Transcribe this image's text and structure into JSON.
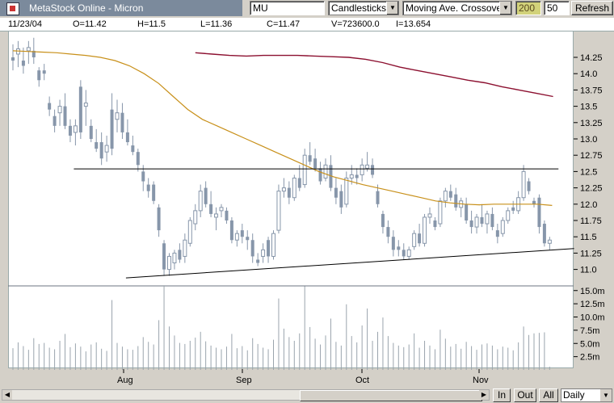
{
  "app": {
    "title": "MetaStock Online - Micron"
  },
  "toolbar": {
    "symbol_value": "MU",
    "chart_type": "Candlesticks",
    "indicator": "Moving Ave. Crossover",
    "period1": "200",
    "period2": "50",
    "refresh_label": "Refresh"
  },
  "quote": {
    "date": "11/23/04",
    "open": "O=11.42",
    "high": "H=11.5",
    "low": "L=11.36",
    "close": "C=11.47",
    "volume": "V=723600.0",
    "interest": "I=13.654"
  },
  "chart_data": {
    "type": "candlestick",
    "price_axis": {
      "ticks": [
        "14.25",
        "14.0",
        "13.75",
        "13.5",
        "13.25",
        "13.0",
        "12.75",
        "12.5",
        "12.25",
        "12.0",
        "11.75",
        "11.5",
        "11.25",
        "11.0"
      ],
      "range": [
        10.8,
        14.75
      ]
    },
    "volume_axis": {
      "ticks": [
        "15.0m",
        "12.5m",
        "10.0m",
        "7.5m",
        "5.0m",
        "2.5m"
      ],
      "range": [
        0,
        18
      ]
    },
    "x_labels": [
      "Aug",
      "Sep",
      "Oct",
      "Nov"
    ],
    "candles": [
      [
        14.25,
        14.45,
        14.05,
        14.2
      ],
      [
        14.3,
        14.5,
        14.1,
        14.38
      ],
      [
        14.2,
        14.4,
        14.0,
        14.12
      ],
      [
        14.35,
        14.5,
        14.15,
        14.4
      ],
      [
        14.35,
        14.55,
        14.15,
        14.25
      ],
      [
        14.05,
        14.1,
        13.8,
        13.9
      ],
      [
        14.05,
        14.15,
        13.9,
        14.0
      ],
      [
        13.55,
        13.65,
        13.35,
        13.45
      ],
      [
        13.35,
        13.45,
        13.1,
        13.2
      ],
      [
        13.4,
        13.6,
        13.2,
        13.5
      ],
      [
        13.5,
        13.7,
        13.15,
        13.2
      ],
      [
        13.2,
        13.3,
        12.95,
        13.05
      ],
      [
        13.1,
        13.3,
        12.9,
        13.2
      ],
      [
        13.8,
        13.9,
        13.0,
        13.1
      ],
      [
        13.5,
        13.75,
        13.2,
        13.55
      ],
      [
        13.2,
        13.3,
        12.95,
        13.0
      ],
      [
        12.95,
        13.15,
        12.8,
        12.85
      ],
      [
        12.95,
        13.1,
        12.6,
        12.7
      ],
      [
        12.8,
        13.05,
        12.65,
        12.9
      ],
      [
        13.45,
        13.7,
        12.75,
        12.85
      ],
      [
        13.3,
        13.6,
        13.1,
        13.4
      ],
      [
        13.4,
        13.55,
        13.0,
        13.1
      ],
      [
        13.1,
        13.3,
        12.9,
        12.95
      ],
      [
        12.9,
        13.05,
        12.75,
        12.8
      ],
      [
        12.8,
        12.85,
        12.5,
        12.6
      ],
      [
        12.5,
        12.6,
        12.2,
        12.35
      ],
      [
        12.3,
        12.4,
        12.1,
        12.2
      ],
      [
        12.3,
        12.35,
        12.0,
        12.05
      ],
      [
        11.95,
        12.0,
        11.5,
        11.6
      ],
      [
        11.4,
        11.45,
        10.9,
        11.0
      ],
      [
        11.0,
        11.25,
        10.9,
        11.2
      ],
      [
        11.1,
        11.3,
        11.0,
        11.25
      ],
      [
        11.3,
        11.4,
        11.1,
        11.15
      ],
      [
        11.2,
        11.55,
        11.1,
        11.45
      ],
      [
        11.4,
        11.8,
        11.35,
        11.75
      ],
      [
        11.7,
        12.0,
        11.6,
        11.9
      ],
      [
        11.9,
        12.3,
        11.8,
        12.2
      ],
      [
        12.25,
        12.35,
        11.95,
        12.0
      ],
      [
        12.0,
        12.2,
        11.8,
        11.85
      ],
      [
        11.8,
        11.95,
        11.6,
        11.85
      ],
      [
        11.9,
        12.0,
        11.8,
        11.95
      ],
      [
        11.9,
        11.95,
        11.7,
        11.75
      ],
      [
        11.75,
        11.8,
        11.4,
        11.45
      ],
      [
        11.45,
        11.6,
        11.35,
        11.55
      ],
      [
        11.6,
        11.7,
        11.4,
        11.5
      ],
      [
        11.5,
        11.6,
        11.3,
        11.45
      ],
      [
        11.45,
        11.55,
        11.1,
        11.2
      ],
      [
        11.15,
        11.25,
        11.05,
        11.1
      ],
      [
        11.2,
        11.4,
        11.1,
        11.3
      ],
      [
        11.45,
        11.5,
        11.1,
        11.2
      ],
      [
        11.2,
        11.6,
        11.15,
        11.55
      ],
      [
        11.6,
        12.3,
        11.55,
        12.2
      ],
      [
        12.2,
        12.4,
        12.1,
        12.25
      ],
      [
        12.25,
        12.35,
        12.0,
        12.1
      ],
      [
        12.1,
        12.45,
        12.05,
        12.4
      ],
      [
        12.4,
        12.6,
        12.2,
        12.25
      ],
      [
        12.3,
        12.85,
        12.25,
        12.75
      ],
      [
        12.75,
        12.95,
        12.6,
        12.65
      ],
      [
        12.7,
        12.85,
        12.5,
        12.55
      ],
      [
        12.55,
        12.65,
        12.3,
        12.35
      ],
      [
        12.4,
        12.7,
        12.35,
        12.6
      ],
      [
        12.6,
        12.75,
        12.2,
        12.25
      ],
      [
        12.25,
        12.4,
        12.0,
        12.1
      ],
      [
        12.2,
        12.3,
        11.85,
        11.95
      ],
      [
        12.0,
        12.5,
        11.95,
        12.4
      ],
      [
        12.4,
        12.6,
        12.3,
        12.45
      ],
      [
        12.45,
        12.55,
        12.3,
        12.4
      ],
      [
        12.45,
        12.7,
        12.35,
        12.6
      ],
      [
        12.55,
        12.8,
        12.5,
        12.6
      ],
      [
        12.6,
        12.7,
        12.4,
        12.45
      ],
      [
        12.2,
        12.3,
        11.95,
        12.0
      ],
      [
        11.85,
        11.9,
        11.55,
        11.65
      ],
      [
        11.65,
        11.75,
        11.4,
        11.5
      ],
      [
        11.5,
        11.6,
        11.2,
        11.3
      ],
      [
        11.35,
        11.45,
        11.2,
        11.3
      ],
      [
        11.3,
        11.4,
        11.15,
        11.2
      ],
      [
        11.2,
        11.35,
        11.15,
        11.3
      ],
      [
        11.35,
        11.6,
        11.3,
        11.55
      ],
      [
        11.55,
        11.7,
        11.35,
        11.4
      ],
      [
        11.4,
        11.85,
        11.35,
        11.8
      ],
      [
        11.8,
        11.95,
        11.7,
        11.85
      ],
      [
        11.75,
        11.8,
        11.6,
        11.65
      ],
      [
        11.7,
        12.1,
        11.65,
        12.05
      ],
      [
        12.05,
        12.25,
        11.95,
        12.2
      ],
      [
        12.2,
        12.3,
        12.05,
        12.1
      ],
      [
        12.15,
        12.25,
        11.9,
        11.95
      ],
      [
        11.95,
        12.1,
        11.8,
        12.05
      ],
      [
        12.0,
        12.1,
        11.7,
        11.75
      ],
      [
        11.75,
        11.9,
        11.55,
        11.65
      ],
      [
        11.65,
        11.85,
        11.55,
        11.8
      ],
      [
        11.8,
        12.0,
        11.65,
        11.7
      ],
      [
        11.7,
        11.9,
        11.55,
        11.85
      ],
      [
        11.85,
        11.95,
        11.6,
        11.65
      ],
      [
        11.6,
        11.7,
        11.4,
        11.5
      ],
      [
        11.55,
        11.8,
        11.5,
        11.75
      ],
      [
        11.75,
        11.95,
        11.7,
        11.9
      ],
      [
        11.95,
        12.05,
        11.85,
        11.9
      ],
      [
        11.9,
        12.2,
        11.85,
        12.1
      ],
      [
        12.1,
        12.6,
        12.05,
        12.5
      ],
      [
        12.35,
        12.4,
        12.15,
        12.2
      ],
      [
        12.05,
        12.1,
        11.95,
        12.0
      ],
      [
        12.1,
        12.15,
        11.55,
        11.65
      ],
      [
        11.7,
        11.75,
        11.35,
        11.4
      ],
      [
        11.4,
        11.5,
        11.3,
        11.45
      ]
    ],
    "volumes": [
      4.1,
      5.2,
      4.5,
      3.8,
      6.0,
      4.9,
      5.1,
      4.2,
      3.9,
      5.5,
      6.8,
      4.3,
      5.0,
      4.4,
      3.5,
      4.8,
      5.2,
      4.0,
      3.6,
      13.2,
      5.1,
      4.4,
      3.9,
      3.8,
      4.5,
      6.2,
      5.3,
      4.8,
      9.4,
      16.0,
      8.2,
      6.5,
      5.1,
      4.9,
      5.5,
      6.1,
      7.2,
      5.4,
      4.6,
      4.2,
      3.9,
      4.4,
      6.8,
      4.1,
      4.5,
      3.7,
      6.0,
      4.9,
      4.2,
      3.9,
      5.7,
      13.5,
      7.8,
      6.2,
      5.5,
      6.9,
      15.8,
      8.1,
      5.9,
      4.8,
      6.5,
      9.7,
      5.3,
      4.6,
      12.4,
      6.4,
      5.2,
      8.4,
      11.6,
      5.5,
      7.2,
      9.9,
      6.4,
      5.1,
      4.6,
      4.3,
      4.8,
      6.9,
      4.2,
      5.5,
      4.6,
      3.9,
      7.6,
      5.9,
      4.4,
      4.9,
      4.0,
      5.3,
      4.5,
      3.8,
      4.8,
      5.0,
      4.6,
      3.9,
      4.4,
      4.2,
      3.7,
      5.2,
      8.2,
      6.6,
      6.9,
      7.0,
      7.1,
      0.6
    ],
    "ma50": [
      14.35,
      14.34,
      14.33,
      14.32,
      14.3,
      14.28,
      14.25,
      14.2,
      14.12,
      14.0,
      13.85,
      13.65,
      13.45,
      13.3,
      13.2,
      13.1,
      13.0,
      12.9,
      12.8,
      12.7,
      12.6,
      12.5,
      12.42,
      12.36,
      12.3,
      12.25,
      12.2,
      12.15,
      12.1,
      12.05,
      12.02,
      12.0,
      11.99,
      12.0,
      12.0,
      12.0,
      12.0,
      11.98
    ],
    "ma200": [
      14.32,
      14.3,
      14.28,
      14.27,
      14.28,
      14.28,
      14.28,
      14.27,
      14.26,
      14.25,
      14.22,
      14.17,
      14.1,
      14.05,
      14.0,
      13.95,
      13.9,
      13.86,
      13.8,
      13.75,
      13.7,
      13.65
    ],
    "ma200_start_index": 35,
    "trendlines": [
      {
        "name": "resistance",
        "from": [
          12,
          12.54
        ],
        "to": [
          105,
          12.54
        ]
      },
      {
        "name": "support",
        "from": [
          22,
          10.87
        ],
        "to": [
          108,
          11.32
        ]
      }
    ]
  },
  "bottom": {
    "btn_in": "In",
    "btn_out": "Out",
    "btn_all": "All",
    "period_value": "Daily"
  },
  "colors": {
    "candle": "#8796aa",
    "ma50": "#c8901a",
    "ma200": "#8c1030",
    "grid": "#9aa4ad"
  }
}
